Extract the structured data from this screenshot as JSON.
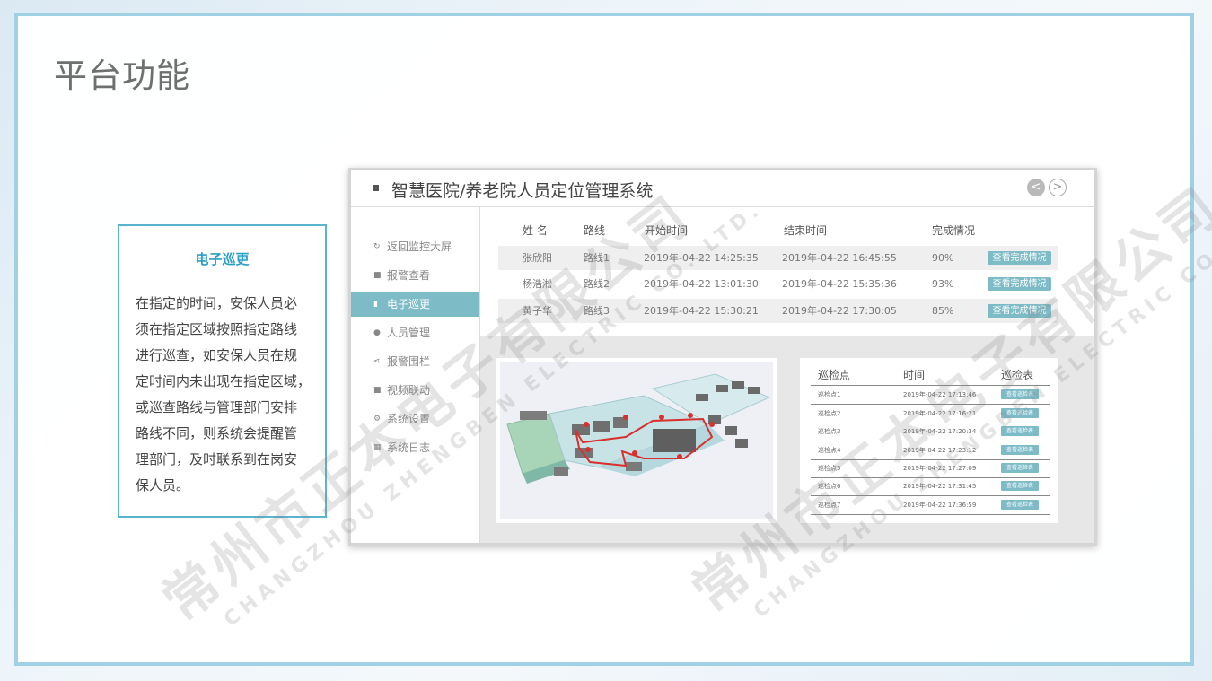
{
  "slide": {
    "title": "平台功能"
  },
  "info": {
    "title": "电子巡更",
    "lines": [
      "在指定的时间，安保人员必",
      "须在指定区域按照指定路线",
      "进行巡查，如安保人员在规",
      "定时间内未出现在指定区域，",
      "或巡查路线与管理部门安排",
      "路线不同，则系统会提醒管",
      "理部门，及时联系到在岗安",
      "保人员。"
    ]
  },
  "app": {
    "title": "智慧医院/养老院人员定位管理系统",
    "nav_prev": "<",
    "nav_next": ">",
    "sidebar": [
      {
        "label": "返回监控大屏",
        "icon": "refresh-icon"
      },
      {
        "label": "报警查看",
        "icon": "alarm-icon"
      },
      {
        "label": "电子巡更",
        "icon": "patrol-icon"
      },
      {
        "label": "人员管理",
        "icon": "person-icon"
      },
      {
        "label": "报警围栏",
        "icon": "fence-icon"
      },
      {
        "label": "视频联动",
        "icon": "video-icon"
      },
      {
        "label": "系统设置",
        "icon": "gear-icon"
      },
      {
        "label": "系统日志",
        "icon": "log-icon"
      }
    ],
    "active_sidebar_index": 2,
    "table": {
      "headers": [
        "姓 名",
        "路线",
        "开始时间",
        "结束时间",
        "完成情况"
      ],
      "rows": [
        {
          "name": "张欣阳",
          "route": "路线1",
          "start": "2019年-04-22 14:25:35",
          "end": "2019年-04-22 16:45:55",
          "pct": "90%",
          "action": "查看完成情况"
        },
        {
          "name": "杨浩淞",
          "route": "路线2",
          "start": "2019年-04-22 13:01:30",
          "end": "2019年-04-22 15:35:36",
          "pct": "93%",
          "action": "查看完成情况"
        },
        {
          "name": "黄子华",
          "route": "路线3",
          "start": "2019年-04-22 15:30:21",
          "end": "2019年-04-22 17:30:05",
          "pct": "85%",
          "action": "查看完成情况"
        }
      ]
    },
    "inspection": {
      "headers": [
        "巡检点",
        "时间",
        "巡检表"
      ],
      "rows": [
        {
          "point": "巡检点1",
          "time": "2019年-04-22  17:13:46",
          "action": "查看巡检表"
        },
        {
          "point": "巡检点2",
          "time": "2019年-04-22  17:16:21",
          "action": "查看巡检表"
        },
        {
          "point": "巡检点3",
          "time": "2019年-04-22  17:20:34",
          "action": "查看巡检表"
        },
        {
          "point": "巡检点4",
          "time": "2019年-04-22  17:23:12",
          "action": "查看巡检表"
        },
        {
          "point": "巡检点5",
          "time": "2019年-04-22  17:27:09",
          "action": "查看巡检表"
        },
        {
          "point": "巡检点6",
          "time": "2019年-04-22  17:31:45",
          "action": "查看巡检表"
        },
        {
          "point": "巡检点7",
          "time": "2019年-04-22  17:36:59",
          "action": "查看巡检表"
        }
      ]
    }
  },
  "watermark": {
    "cn": "常州市正本电子有限公司",
    "en": "CHANGZHOU ZHENGBEN ELECTRIC CO.,LTD."
  },
  "colors": {
    "accent": "#7dbbc7",
    "frame": "#9fd0e3",
    "info_border": "#5ab3cf",
    "info_title": "#2a9fc6",
    "route": "#d9302f"
  }
}
